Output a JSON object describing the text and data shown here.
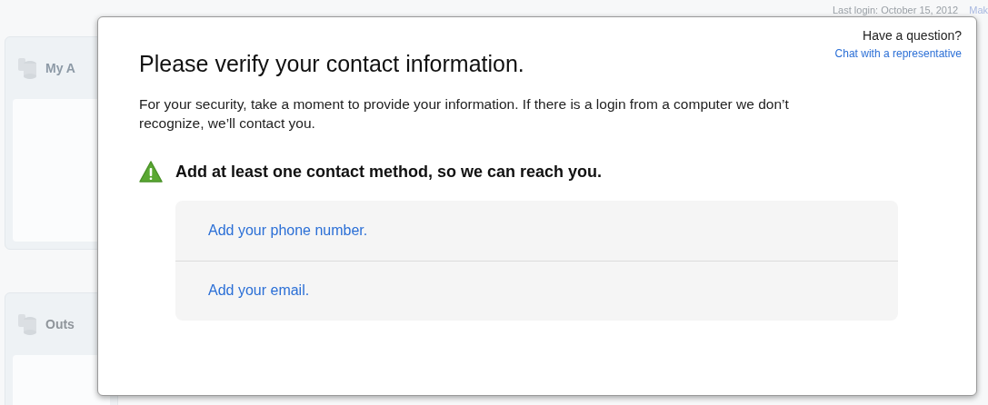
{
  "background": {
    "last_login": "Last login: October 15, 2012",
    "top_link": "Mak",
    "panels": [
      {
        "title": "My A"
      },
      {
        "title": "Outs"
      }
    ]
  },
  "dialog": {
    "help": {
      "question": "Have a question?",
      "link": "Chat with a representative"
    },
    "title": "Please verify your contact information.",
    "intro": "For your security, take a moment to provide your information. If there is a login from a computer we don’t recognize, we’ll contact you.",
    "warning": "Add at least one contact method, so we can reach you.",
    "options": [
      "Add your phone number.",
      "Add your email."
    ]
  }
}
